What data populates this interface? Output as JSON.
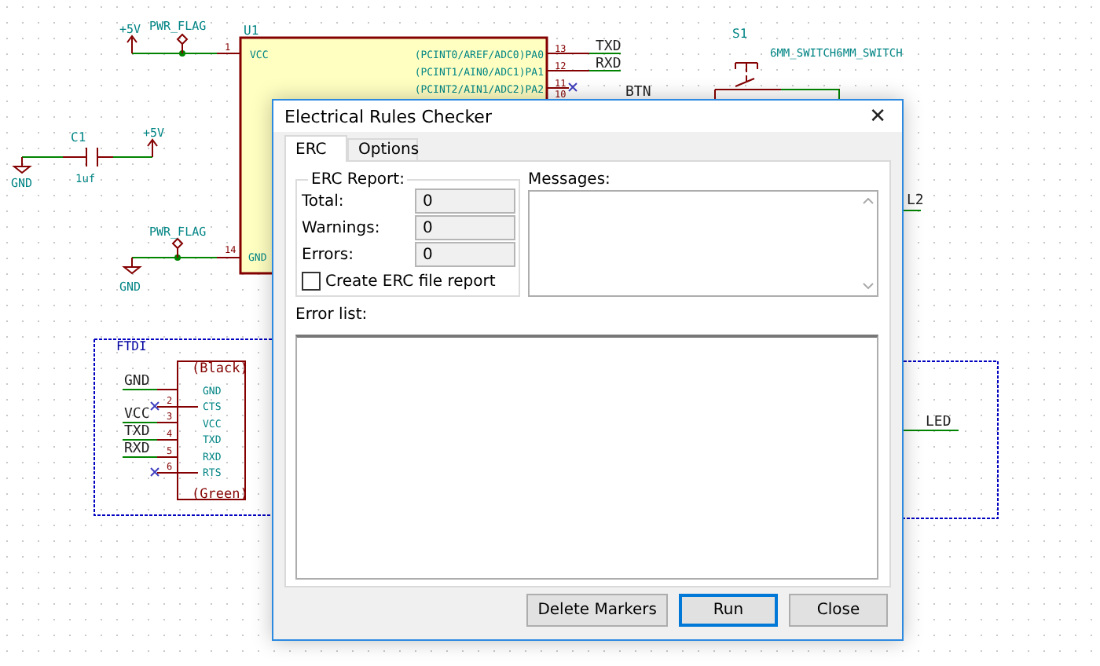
{
  "schematic": {
    "labels": [
      {
        "text": "+5V",
        "kind": "power"
      },
      {
        "text": "PWR_FLAG",
        "kind": "power"
      },
      {
        "text": "U1",
        "kind": "ref"
      },
      {
        "text": "1",
        "kind": "pin_number"
      },
      {
        "text": "VCC",
        "kind": "pin_name"
      },
      {
        "text": "(PCINT0/AREF/ADC0)PA0",
        "kind": "pin_name"
      },
      {
        "text": "(PCINT1/AIN0/ADC1)PA1",
        "kind": "pin_name"
      },
      {
        "text": "(PCINT2/AIN1/ADC2)PA2",
        "kind": "pin_name"
      },
      {
        "text": "13",
        "kind": "pin_number"
      },
      {
        "text": "12",
        "kind": "pin_number"
      },
      {
        "text": "11",
        "kind": "pin_number"
      },
      {
        "text": "10",
        "kind": "pin_number"
      },
      {
        "text": "TXD",
        "kind": "net"
      },
      {
        "text": "RXD",
        "kind": "net"
      },
      {
        "text": "BTN",
        "kind": "net"
      },
      {
        "text": "S1",
        "kind": "ref"
      },
      {
        "text": "6MM_SWITCH6MM_SWITCH",
        "kind": "value"
      },
      {
        "text": "C1",
        "kind": "ref"
      },
      {
        "text": "+5V",
        "kind": "power"
      },
      {
        "text": "GND",
        "kind": "power"
      },
      {
        "text": "1uf",
        "kind": "value"
      },
      {
        "text": "PWR_FLAG",
        "kind": "power"
      },
      {
        "text": "14",
        "kind": "pin_number"
      },
      {
        "text": "GND",
        "kind": "pin_name"
      },
      {
        "text": "GND",
        "kind": "power"
      },
      {
        "text": "L2",
        "kind": "net"
      },
      {
        "text": "LED",
        "kind": "net"
      },
      {
        "text": "FTDI",
        "kind": "sheet"
      },
      {
        "text": "GND",
        "kind": "net"
      },
      {
        "text": "VCC",
        "kind": "net"
      },
      {
        "text": "TXD",
        "kind": "net"
      },
      {
        "text": "RXD",
        "kind": "net"
      },
      {
        "text": "(Black)",
        "kind": "body"
      },
      {
        "text": "GND",
        "kind": "pin_name"
      },
      {
        "text": "CTS",
        "kind": "pin_name"
      },
      {
        "text": "VCC",
        "kind": "pin_name"
      },
      {
        "text": "TXD",
        "kind": "pin_name"
      },
      {
        "text": "RXD",
        "kind": "pin_name"
      },
      {
        "text": "RTS",
        "kind": "pin_name"
      },
      {
        "text": "(Green)",
        "kind": "body"
      },
      {
        "text": "2",
        "kind": "pin_number"
      },
      {
        "text": "3",
        "kind": "pin_number"
      },
      {
        "text": "4",
        "kind": "pin_number"
      },
      {
        "text": "5",
        "kind": "pin_number"
      },
      {
        "text": "6",
        "kind": "pin_number"
      }
    ]
  },
  "dialog": {
    "title": "Electrical Rules Checker",
    "close": "✕",
    "tabs": [
      {
        "label": "ERC",
        "selected": true
      },
      {
        "label": "Options",
        "selected": false
      }
    ],
    "report": {
      "title": "ERC Report:",
      "rows": [
        {
          "label": "Total:",
          "value": "0"
        },
        {
          "label": "Warnings:",
          "value": "0"
        },
        {
          "label": "Errors:",
          "value": "0"
        }
      ]
    },
    "create_report": {
      "label": "Create ERC file report",
      "checked": false
    },
    "messages_label": "Messages:",
    "error_list_label": "Error list:",
    "buttons": [
      {
        "label": "Delete Markers",
        "default": false
      },
      {
        "label": "Run",
        "default": true
      },
      {
        "label": "Close",
        "default": false
      }
    ]
  }
}
